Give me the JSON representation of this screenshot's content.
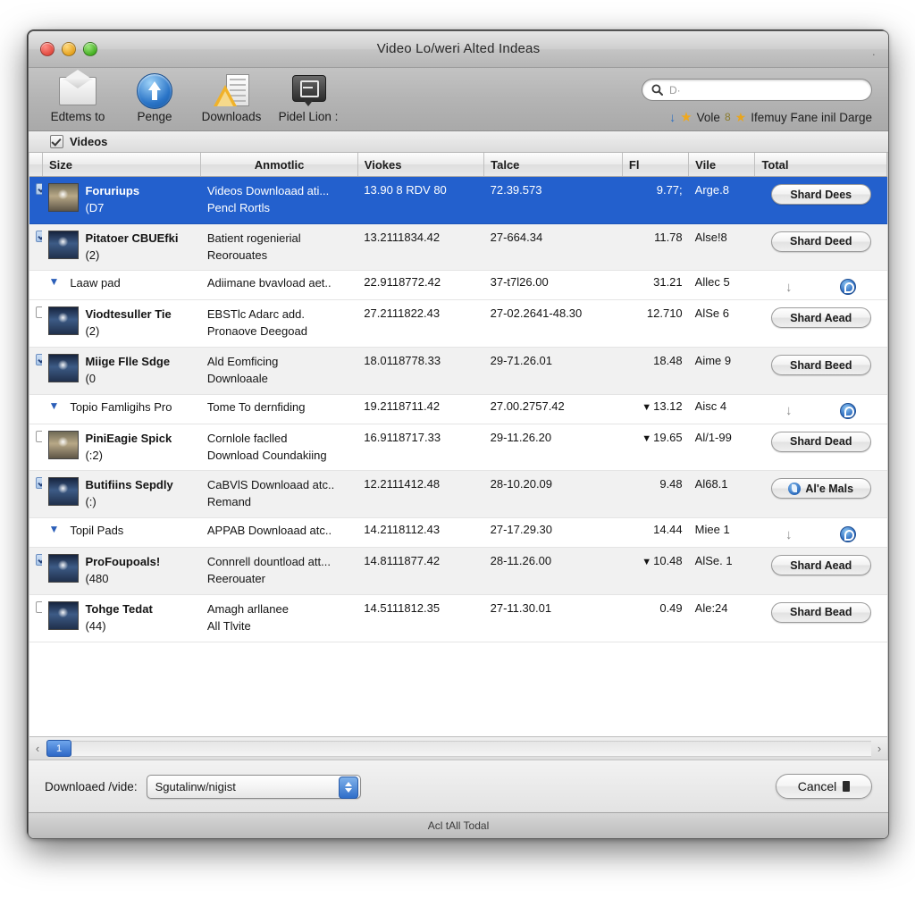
{
  "window": {
    "title": "Video Lo/weri Alted Indeas",
    "title_right_glyph": "·"
  },
  "toolbar": {
    "items": [
      {
        "label": "Edtems to",
        "icon": "envelope-icon"
      },
      {
        "label": "Penge",
        "icon": "upload-arrow-icon"
      },
      {
        "label": "Downloads",
        "icon": "downloads-warning-icon"
      },
      {
        "label": "Pidel Lion :",
        "icon": "dark-badge-icon"
      }
    ],
    "search": {
      "placeholder": "D·",
      "icon": "search-icon"
    },
    "right_row": {
      "download_icon": "download-arrow-icon",
      "star_icon": "star-icon",
      "text1": "Vole",
      "separator": "8",
      "star2_icon": "star-icon",
      "text2": "Ifemuy Fane inil Darge"
    }
  },
  "group_header": {
    "label": "Videos",
    "checked": true
  },
  "table": {
    "columns": [
      {
        "key": "size",
        "label": "Size",
        "align": "left"
      },
      {
        "key": "anmo",
        "label": "Anmotlic",
        "align": "left"
      },
      {
        "key": "viokes",
        "label": "Viokes",
        "align": "left"
      },
      {
        "key": "talce",
        "label": "Talce",
        "align": "left"
      },
      {
        "key": "fl",
        "label": "Fl",
        "align": "right"
      },
      {
        "key": "vile",
        "label": "Vile",
        "align": "left"
      },
      {
        "key": "total",
        "label": "Total",
        "align": "left"
      }
    ],
    "rows": [
      {
        "kind": "item",
        "selected": true,
        "checkbox": "on",
        "thumb": "warm",
        "name1": "Foruriups",
        "name2": "(D7",
        "desc1": "Videos Downloaad ati...",
        "desc2": "Pencl Rortls",
        "viokes": "13.90 8 RDV 80",
        "talce": "72.39.573",
        "fl": "9.77;",
        "vile": "Arge.8",
        "action": {
          "type": "button",
          "label": "Shard Dees"
        }
      },
      {
        "kind": "item",
        "selected": false,
        "alt": true,
        "checkbox": "on",
        "thumb": "cool",
        "name1": "Pitatoer CBUEfki",
        "name2": "(2)",
        "desc1": "Batient rogenierial",
        "desc2": "Reorouates",
        "viokes": "13.2111834.42",
        "talce": "27-664.34",
        "fl": "11.78",
        "vile": "Alse!8",
        "action": {
          "type": "button",
          "label": "Shard Deed"
        }
      },
      {
        "kind": "sub",
        "selected": false,
        "alt": false,
        "name1": "Laaw pad",
        "desc1": "Adiimane bvavload aet..",
        "viokes": "22.9118772.42",
        "talce": "37-t7l26.00",
        "fl": "31.21",
        "vile": "Allec 5",
        "action": {
          "type": "icons"
        }
      },
      {
        "kind": "item",
        "selected": false,
        "alt": false,
        "checkbox": "off",
        "thumb": "cool",
        "name1": "Viodtesuller Tie",
        "name2": "(2)",
        "desc1": "EBSTlc Adarc add.",
        "desc2": "Pronaove Deegoad",
        "viokes": "27.2111822.43",
        "talce": "27-02.2641-48.30",
        "fl": "12.710",
        "vile": "AlSe 6",
        "action": {
          "type": "button",
          "label": "Shard Aead"
        }
      },
      {
        "kind": "item",
        "selected": false,
        "alt": true,
        "checkbox": "on",
        "thumb": "cool",
        "name1": "Miige Flle Sdge",
        "name2": "(0",
        "desc1": "Ald Eomficing",
        "desc2": "Downloaale",
        "viokes": "18.0118778.33",
        "talce": "29-71.26.01",
        "fl": "18.48",
        "vile": "Aime 9",
        "action": {
          "type": "button",
          "label": "Shard Beed"
        }
      },
      {
        "kind": "sub",
        "selected": false,
        "alt": false,
        "name1": "Topio Famligihs Pro",
        "desc1": "Tome To dernfiding",
        "viokes": "19.2118711.42",
        "talce": "27.00.2757.42",
        "fl": "13.12",
        "fl_caret": true,
        "vile": "Aisc 4",
        "action": {
          "type": "icons"
        }
      },
      {
        "kind": "item",
        "selected": false,
        "alt": false,
        "checkbox": "off",
        "thumb": "warm",
        "name1": "PiniEagie Spick",
        "name2": "(:2)",
        "desc1": "Cornlole faclled",
        "desc2": "Download Coundakiing",
        "viokes": "16.9118717.33",
        "talce": "29-11.26.20",
        "fl": "19.65",
        "fl_caret": true,
        "vile": "Al/1-99",
        "action": {
          "type": "button",
          "label": "Shard Dead"
        }
      },
      {
        "kind": "item",
        "selected": false,
        "alt": true,
        "checkbox": "on",
        "thumb": "cool",
        "name1": "Butifiins Sepdly",
        "name2": "(:)",
        "desc1": "CaBVlS Downloaad atc..",
        "desc2": "Remand",
        "viokes": "12.2111412.48",
        "talce": "28-10.20.09",
        "fl": "9.48",
        "vile": "Al68.1",
        "action": {
          "type": "button",
          "label": "Al'e Mals",
          "icon": "swirl-icon"
        }
      },
      {
        "kind": "sub",
        "selected": false,
        "alt": false,
        "name1": "Topil Pads",
        "desc1": "APPAB Downloaad atc..",
        "viokes": "14.2118112.43",
        "talce": "27-17.29.30",
        "fl": "14.44",
        "vile": "Miee 1",
        "action": {
          "type": "icons"
        }
      },
      {
        "kind": "item",
        "selected": false,
        "alt": true,
        "checkbox": "on",
        "thumb": "cool",
        "name1": "ProFoupoals!",
        "name2": "(480",
        "desc1": "Connrell dountload att...",
        "desc2": "Reerouater",
        "viokes": "14.8111877.42",
        "talce": "28-11.26.00",
        "fl": "10.48",
        "fl_caret": true,
        "vile": "AlSe. 1",
        "action": {
          "type": "button",
          "label": "Shard Aead"
        }
      },
      {
        "kind": "item",
        "selected": false,
        "alt": false,
        "checkbox": "off",
        "thumb": "cool",
        "name1": "Tohge Tedat",
        "name2": "(44)",
        "desc1": "Amagh arllanee",
        "desc2": "All Tlvite",
        "viokes": "14.5111812.35",
        "talce": "27-11.30.01",
        "fl": "0.49",
        "vile": "Ale:24",
        "action": {
          "type": "button",
          "label": "Shard Bead"
        }
      }
    ]
  },
  "hscroll": {
    "left_arrow": "‹",
    "right_arrow": "›",
    "page": "1"
  },
  "footer": {
    "label": "Downloaed /vide:",
    "popup_value": "Sgutalinw/nigist",
    "cancel_label": "Cancel"
  },
  "statusbar": {
    "text": "Acl tAll Todal"
  },
  "colors": {
    "selection": "#2360cd",
    "accent_blue": "#2d6cc0",
    "star": "#f0a81c"
  }
}
